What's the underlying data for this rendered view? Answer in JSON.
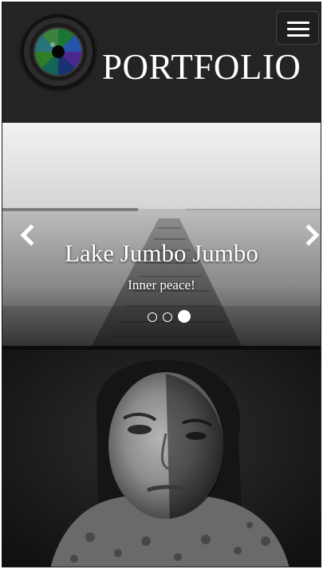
{
  "header": {
    "brand": "PORTFOLIO",
    "logo_icon": "camera-lens-icon",
    "menu_icon": "hamburger-menu-icon"
  },
  "carousel": {
    "title": "Lake Jumbo Jumbo",
    "subtitle": "Inner peace!",
    "prev_icon": "chevron-left-icon",
    "next_icon": "chevron-right-icon",
    "slide_count": 3,
    "active_index": 2
  },
  "colors": {
    "header_bg": "#242424",
    "text": "#ffffff"
  }
}
